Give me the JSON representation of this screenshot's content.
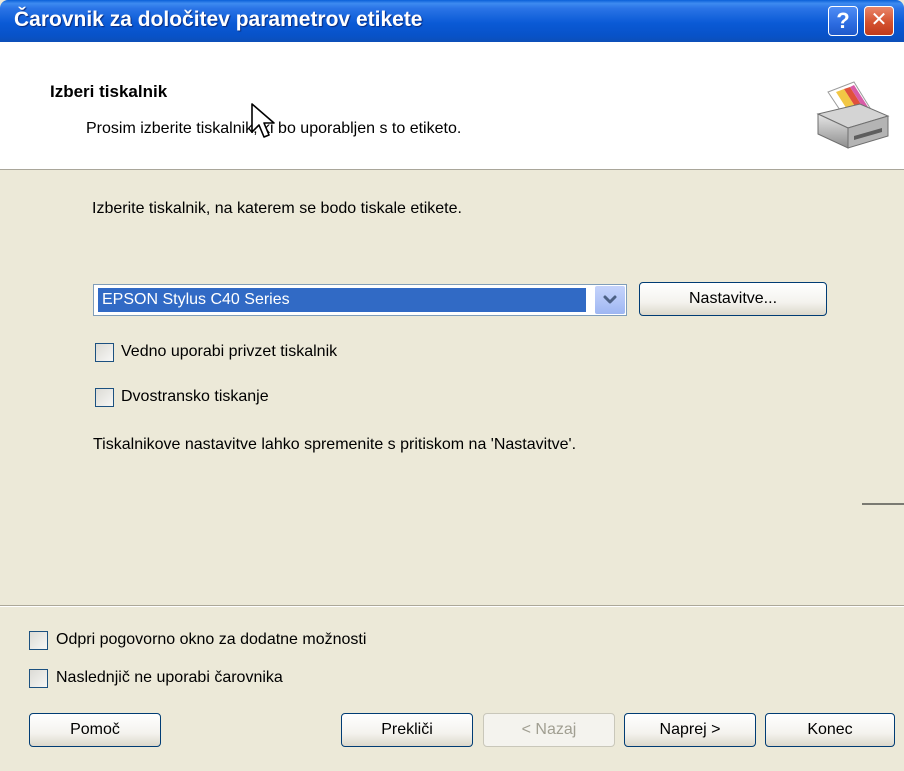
{
  "window": {
    "title": "Čarovnik za določitev parametrov etikete",
    "help_label": "?",
    "close_label": "✕"
  },
  "header": {
    "title": "Izberi tiskalnik",
    "subtitle": "Prosim izberite tiskalnik, ki bo uporabljen s to etiketo.",
    "icon": "printer-icon"
  },
  "content": {
    "instruction": "Izberite tiskalnik, na katerem se bodo tiskale etikete.",
    "printer_select": {
      "value": "EPSON Stylus C40 Series"
    },
    "settings_button": "Nastavitve...",
    "checkbox_default_printer": {
      "label": "Vedno uporabi privzet tiskalnik",
      "checked": false
    },
    "checkbox_duplex": {
      "label": "Dvostransko tiskanje",
      "checked": false
    },
    "note": "Tiskalnikove nastavitve lahko spremenite s pritiskom na 'Nastavitve'."
  },
  "footer": {
    "checkbox_more_options": {
      "label": "Odpri pogovorno okno za dodatne možnosti",
      "checked": false
    },
    "checkbox_skip_wizard": {
      "label": "Naslednjič ne uporabi čarovnika",
      "checked": false
    },
    "buttons": {
      "help": "Pomoč",
      "cancel": "Prekliči",
      "back": "< Nazaj",
      "next": "Naprej >",
      "finish": "Konec"
    }
  },
  "colors": {
    "titlebar": "#0A5AD6",
    "selection": "#316AC5",
    "dialog_bg": "#ECE9D8"
  }
}
